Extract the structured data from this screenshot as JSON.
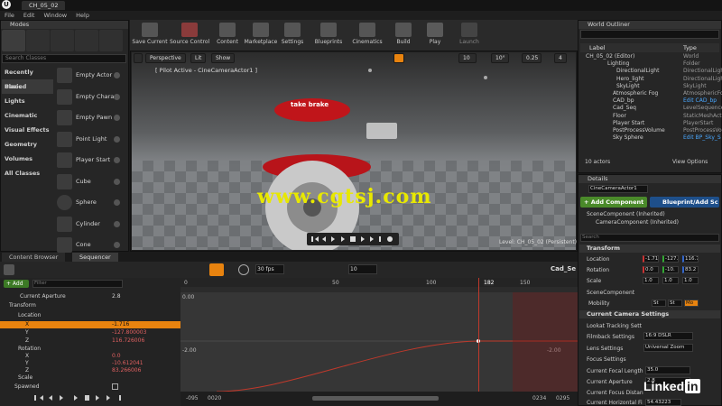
{
  "app": {
    "tab_title": "CH_05_02",
    "logo_text": "U"
  },
  "menu": [
    "File",
    "Edit",
    "Window",
    "Help"
  ],
  "modes": {
    "title": "Modes",
    "search_placeholder": "Search Classes",
    "categories": [
      "Recently Placed",
      "Basic",
      "Lights",
      "Cinematic",
      "Visual Effects",
      "Geometry",
      "Volumes",
      "All Classes"
    ],
    "active_category": "Basic",
    "actors": [
      "Empty Actor",
      "Empty Chara",
      "Empty Pawn",
      "Point Light",
      "Player Start",
      "Cube",
      "Sphere",
      "Cylinder",
      "Cone"
    ]
  },
  "toolbar": [
    "Save Current",
    "Source Control",
    "Content",
    "Marketplace",
    "Settings",
    "Blueprints",
    "Cinematics",
    "Build",
    "Play",
    "Launch"
  ],
  "viewport": {
    "perspective": "Perspective",
    "lit": "Lit",
    "show": "Show",
    "pilot": "[ Pilot Active - CineCameraActor1 ]",
    "level": "Level:  CH_05_02 (Persistent)",
    "snap_values": [
      "10",
      "10°",
      "0.25",
      "4"
    ],
    "watermark": "www.cgtsj.com",
    "brake_text": "take brake"
  },
  "outliner": {
    "title": "World Outliner",
    "col_label": "Label",
    "col_type": "Type",
    "rows": [
      {
        "label": "CH_05_02 (Editor)",
        "type": "World",
        "indent": 0,
        "link": false
      },
      {
        "label": "Lighting",
        "type": "Folder",
        "indent": 1,
        "link": false
      },
      {
        "label": "DirectionalLight",
        "type": "DirectionalLight",
        "indent": 2,
        "link": false
      },
      {
        "label": "Hero_light",
        "type": "DirectionalLight",
        "indent": 2,
        "link": false
      },
      {
        "label": "SkyLight",
        "type": "SkyLight",
        "indent": 2,
        "link": false
      },
      {
        "label": "Atmospheric Fog",
        "type": "AtmosphericFog",
        "indent": 1,
        "link": false
      },
      {
        "label": "CAD_bp",
        "type": "Edit CAD_bp",
        "indent": 1,
        "link": true
      },
      {
        "label": "Cad_Seq",
        "type": "LevelSequence",
        "indent": 1,
        "link": false
      },
      {
        "label": "Floor",
        "type": "StaticMeshActor",
        "indent": 1,
        "link": false
      },
      {
        "label": "Player Start",
        "type": "PlayerStart",
        "indent": 1,
        "link": false
      },
      {
        "label": "PostProcessVolume",
        "type": "PostProcessVo",
        "indent": 1,
        "link": false
      },
      {
        "label": "Sky Sphere",
        "type": "Edit BP_Sky_S",
        "indent": 1,
        "link": true
      }
    ],
    "count": "10 actors",
    "view_options": "View Options"
  },
  "details": {
    "title": "Details",
    "name_field": "CineCameraActor1",
    "add_component": "+ Add Component",
    "blueprint": "Blueprint/Add Sc",
    "components": [
      "SceneComponent (Inherited)",
      "CameraComponent (Inherited)"
    ],
    "search_placeholder": "Search",
    "transform": "Transform",
    "location_label": "Location",
    "location": [
      "-1.71",
      "-127.",
      "116.7"
    ],
    "rotation_label": "Rotation",
    "rotation": [
      "0.0",
      "-10.",
      "83.2"
    ],
    "scale_label": "Scale",
    "scale": [
      "1.0",
      "1.0",
      "1.0"
    ],
    "scene_component": "SceneComponent",
    "mobility_label": "Mobility",
    "mobility": [
      "St",
      "St",
      "Mo"
    ],
    "camera_settings": "Current Camera Settings",
    "lookat": "Lookat Tracking Sett",
    "filmback_label": "Filmback Settings",
    "filmback_value": "16:9 DSLR",
    "lens_label": "Lens Settings",
    "lens_value": "Universal Zoom",
    "focus_label": "Focus Settings",
    "focal_label": "Current Focal Length",
    "focal_value": "35.0",
    "aperture_label": "Current Aperture",
    "aperture_value": "2.8",
    "focus_dist_label": "Current Focus Distan",
    "hfov_label": "Current Horizontal Fi",
    "hfov_value": "54.43223"
  },
  "sequencer": {
    "tabs": [
      "Content Browser",
      "Sequencer"
    ],
    "fps": "30 fps",
    "snap": "10",
    "seq_name": "Cad_Se",
    "add": "+ Add",
    "filter_placeholder": "Filter",
    "tracks": [
      {
        "label": "Current Aperture",
        "value": "2.8",
        "indent": 16
      },
      {
        "label": "Transform",
        "value": "",
        "indent": 8
      },
      {
        "label": "Location",
        "value": "",
        "indent": 14
      },
      {
        "label": "X",
        "value": "-1.716",
        "indent": 26,
        "highlight": true
      },
      {
        "label": "Y",
        "value": "-127.800003",
        "indent": 26
      },
      {
        "label": "Z",
        "value": "116.726006",
        "indent": 26
      },
      {
        "label": "Rotation",
        "value": "",
        "indent": 14
      },
      {
        "label": "X",
        "value": "0.0",
        "indent": 26
      },
      {
        "label": "Y",
        "value": "-10.612041",
        "indent": 26
      },
      {
        "label": "Z",
        "value": "83.266006",
        "indent": 26
      },
      {
        "label": "Scale",
        "value": "",
        "indent": 14
      },
      {
        "label": "Spawned",
        "value": "",
        "indent": 8
      }
    ],
    "ruler": [
      "0",
      "50",
      "100",
      "150",
      "182"
    ],
    "playhead_frame": "182",
    "curve_labels": [
      "0.00",
      "-2.00",
      "-2.00"
    ],
    "bottom_left": [
      "-095",
      "0020"
    ],
    "bottom_right": [
      "0234",
      "0295"
    ]
  },
  "branding": {
    "name": "Linked",
    "in": "in"
  }
}
